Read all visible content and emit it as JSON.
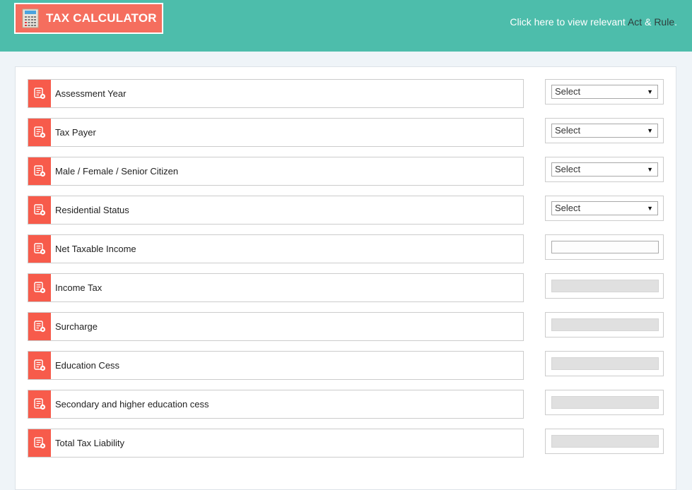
{
  "header": {
    "title": "TAX CALCULATOR",
    "logo_icon": "calculator-icon",
    "link_prefix": "Click here to view relevant ",
    "link_act": "Act",
    "link_amp": " & ",
    "link_rule": "Rule",
    "link_suffix": "."
  },
  "colors": {
    "header_bg": "#4dbdab",
    "accent": "#f75b4b"
  },
  "rows": [
    {
      "label": "Assessment Year",
      "type": "select",
      "value": "Select",
      "icon": "list-settings-icon"
    },
    {
      "label": "Tax Payer",
      "type": "select",
      "value": "Select",
      "icon": "list-settings-icon"
    },
    {
      "label": "Male / Female / Senior Citizen",
      "type": "select",
      "value": "Select",
      "icon": "list-settings-icon"
    },
    {
      "label": "Residential Status",
      "type": "select",
      "value": "Select",
      "icon": "list-settings-icon"
    },
    {
      "label": "Net Taxable Income",
      "type": "input",
      "value": "",
      "icon": "list-settings-icon"
    },
    {
      "label": "Income Tax",
      "type": "readonly",
      "value": "",
      "icon": "list-settings-icon"
    },
    {
      "label": "Surcharge",
      "type": "readonly",
      "value": "",
      "icon": "list-settings-icon"
    },
    {
      "label": "Education Cess",
      "type": "readonly",
      "value": "",
      "icon": "list-settings-icon"
    },
    {
      "label": "Secondary and higher education cess",
      "type": "readonly",
      "value": "",
      "icon": "list-settings-icon"
    },
    {
      "label": "Total Tax Liability",
      "type": "readonly",
      "value": "",
      "icon": "list-settings-icon"
    }
  ]
}
